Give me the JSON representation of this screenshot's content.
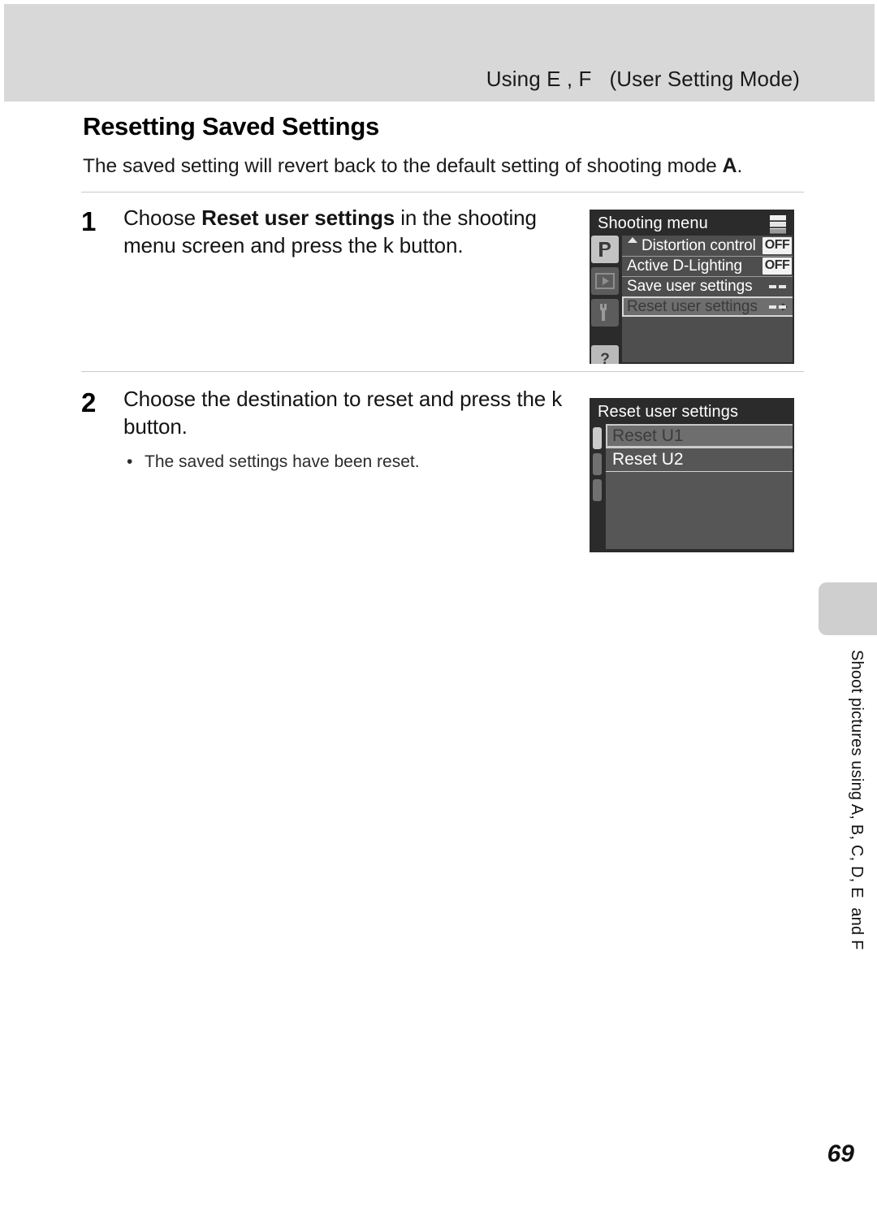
{
  "header": {
    "running_title": "Using E , F   (User Setting Mode)"
  },
  "page": {
    "heading": "Resetting Saved Settings",
    "intro_before": "The saved setting will revert back to the default setting of shooting mode ",
    "intro_symbol": "A",
    "intro_after": ".",
    "number": "69"
  },
  "steps": [
    {
      "number": "1",
      "text_parts": {
        "p1": "Choose ",
        "bold": "Reset user settings",
        "p2": " in the shooting menu screen and press the k   button."
      }
    },
    {
      "number": "2",
      "text_parts": {
        "p1": "Choose the destination to reset and press the k   button.",
        "bold": "",
        "p2": ""
      },
      "bullet": "•",
      "note": "The saved settings have been reset."
    }
  ],
  "shooting_menu_screen": {
    "title": "Shooting menu",
    "menu_icon": "menu-stack-icon",
    "rail": [
      {
        "name": "shooting-mode-tab",
        "glyph": "P",
        "state": "active"
      },
      {
        "name": "playback-tab",
        "glyph": "▶",
        "state": "dim"
      },
      {
        "name": "setup-tab",
        "glyph": "wrench",
        "state": "dim"
      },
      {
        "name": "help-tab",
        "glyph": "?",
        "state": "help"
      }
    ],
    "rows": [
      {
        "label": "Distortion control",
        "value": "OFF",
        "selected": false,
        "scroll_up": true
      },
      {
        "label": "Active D-Lighting",
        "value": "OFF",
        "selected": false,
        "scroll_up": false
      },
      {
        "label": "Save user settings",
        "value": "--",
        "selected": false,
        "scroll_up": false
      },
      {
        "label": "Reset user settings",
        "value": "--",
        "selected": true,
        "scroll_up": false
      }
    ]
  },
  "reset_menu_screen": {
    "title": "Reset user settings",
    "rows": [
      {
        "label": "Reset U1",
        "selected": true
      },
      {
        "label": "Reset U2",
        "selected": false
      }
    ]
  },
  "side_tab": {
    "label": "Shoot pictures using A, B, C, D, E  and F"
  }
}
